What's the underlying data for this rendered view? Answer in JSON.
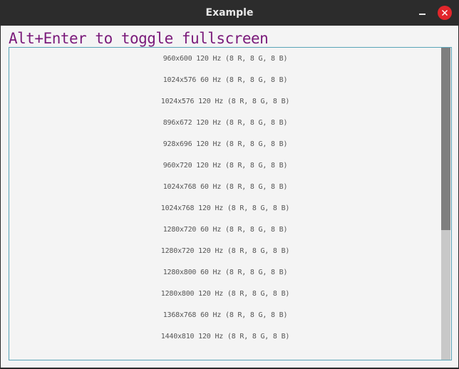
{
  "window": {
    "title": "Example"
  },
  "heading": "Alt+Enter to toggle fullscreen",
  "modes": [
    "960x600 120 Hz (8 R, 8 G, 8 B)",
    "1024x576 60 Hz (8 R, 8 G, 8 B)",
    "1024x576 120 Hz (8 R, 8 G, 8 B)",
    "896x672 120 Hz (8 R, 8 G, 8 B)",
    "928x696 120 Hz (8 R, 8 G, 8 B)",
    "960x720 120 Hz (8 R, 8 G, 8 B)",
    "1024x768 60 Hz (8 R, 8 G, 8 B)",
    "1024x768 120 Hz (8 R, 8 G, 8 B)",
    "1280x720 60 Hz (8 R, 8 G, 8 B)",
    "1280x720 120 Hz (8 R, 8 G, 8 B)",
    "1280x800 60 Hz (8 R, 8 G, 8 B)",
    "1280x800 120 Hz (8 R, 8 G, 8 B)",
    "1368x768 60 Hz (8 R, 8 G, 8 B)",
    "1440x810 120 Hz (8 R, 8 G, 8 B)"
  ],
  "scroll": {
    "thumb_fraction": 0.585,
    "position_fraction": 0.0
  },
  "colors": {
    "heading": "#7a1a7a",
    "close_button": "#e2262b",
    "list_border": "#5aa4b8"
  },
  "icons": {
    "minimize": "minimize-icon",
    "close": "close-icon"
  }
}
